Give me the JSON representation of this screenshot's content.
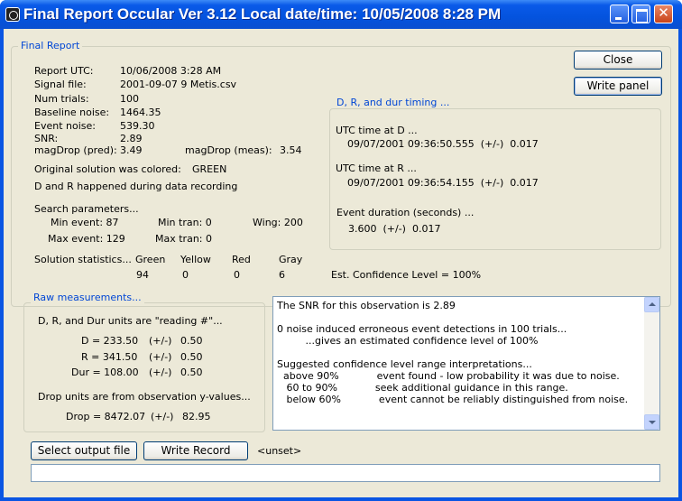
{
  "window": {
    "title": "Final Report Occular Ver 3.12  Local date/time:  10/05/2008  8:28 PM"
  },
  "report": {
    "group_title": "Final Report",
    "rows": [
      {
        "label": "Report UTC:",
        "value": "10/06/2008 3:28 AM"
      },
      {
        "label": "Signal file:",
        "value": "2001-09-07 9 Metis.csv"
      },
      {
        "label": "Num trials:",
        "value": "100"
      },
      {
        "label": "Baseline noise:",
        "value": "1464.35"
      },
      {
        "label": "Event noise:",
        "value": "539.30"
      },
      {
        "label": "SNR:",
        "value": "2.89"
      }
    ],
    "magdrop_pred_label": "magDrop (pred):",
    "magdrop_pred_value": "3.49",
    "magdrop_meas_label": "magDrop (meas):",
    "magdrop_meas_value": "3.54",
    "original_solution_text": "Original solution was colored:",
    "original_solution_color": "GREEN",
    "recording_note": "D and R happened during data recording",
    "search_title": "Search parameters...",
    "min_event": "Min event: 87",
    "min_tran": "Min tran: 0",
    "wing": "Wing: 200",
    "max_event": "Max event: 129",
    "max_tran": "Max tran: 0",
    "solution_stats_label": "Solution statistics...",
    "stats": [
      {
        "name": "Green",
        "value": "94"
      },
      {
        "name": "Yellow",
        "value": "0"
      },
      {
        "name": "Red",
        "value": "0"
      },
      {
        "name": "Gray",
        "value": "6"
      }
    ],
    "confidence": "Est. Confidence Level = 100%"
  },
  "buttons": {
    "close": "Close",
    "write_panel": "Write panel",
    "select_output": "Select output file",
    "write_record": "Write Record",
    "output_path": "<unset>"
  },
  "timing": {
    "group_title": "D, R, and dur timing ...",
    "d_label": "UTC time at D ...",
    "d_value": "09/07/2001 09:36:50.555  (+/-)  0.017",
    "r_label": "UTC time at R ...",
    "r_value": "09/07/2001 09:36:54.155  (+/-)  0.017",
    "dur_label": "Event duration (seconds) ...",
    "dur_value": "3.600  (+/-)  0.017"
  },
  "raw": {
    "group_title": "Raw measurements...",
    "units_note": "D, R, and Dur units are \"reading #\"...",
    "rows": [
      {
        "label": "D = 233.50",
        "pm": "(+/-)",
        "err": "0.50"
      },
      {
        "label": "R = 341.50",
        "pm": "(+/-)",
        "err": "0.50"
      },
      {
        "label": "Dur = 108.00",
        "pm": "(+/-)",
        "err": "0.50"
      }
    ],
    "drop_note": "Drop units are from observation y-values...",
    "drop_label": "Drop = 8472.07",
    "drop_pm": "(+/-)",
    "drop_err": "82.95"
  },
  "memo": {
    "lines": [
      "The SNR for this observation is 2.89",
      "",
      "0 noise induced erroneous event detections in 100 trials...",
      "         ...gives an estimated confidence level of 100%",
      "",
      "Suggested confidence level range interpretations...",
      "  above 90%            event found - low probability it was due to noise.",
      "   60 to 90%            seek additional guidance in this range.",
      "   below 60%            event cannot be reliably distinguished from noise."
    ]
  },
  "status_field": {
    "value": ""
  }
}
